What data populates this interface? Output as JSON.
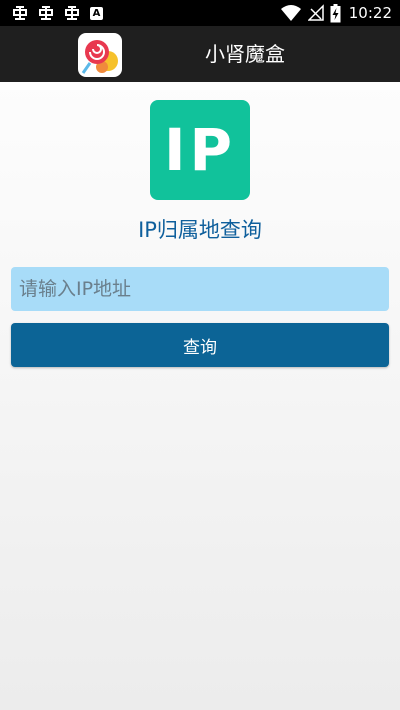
{
  "status_bar": {
    "time": "10:22",
    "notification_icons": [
      "bug-icon",
      "bug-icon",
      "bug-icon",
      "a-icon"
    ],
    "system_icons": [
      "wifi-icon",
      "no-signal-icon",
      "battery-charging-icon"
    ],
    "a_icon_label": "A"
  },
  "title_bar": {
    "app_name": "小肾魔盒",
    "background": "#1f1f1f"
  },
  "main": {
    "logo_text": "IP",
    "logo_color": "#11c29b",
    "tool_title": "IP归属地查询",
    "input_placeholder": "请输入IP地址",
    "input_value": "",
    "query_button_label": "查询",
    "accent_color": "#0c6496"
  }
}
